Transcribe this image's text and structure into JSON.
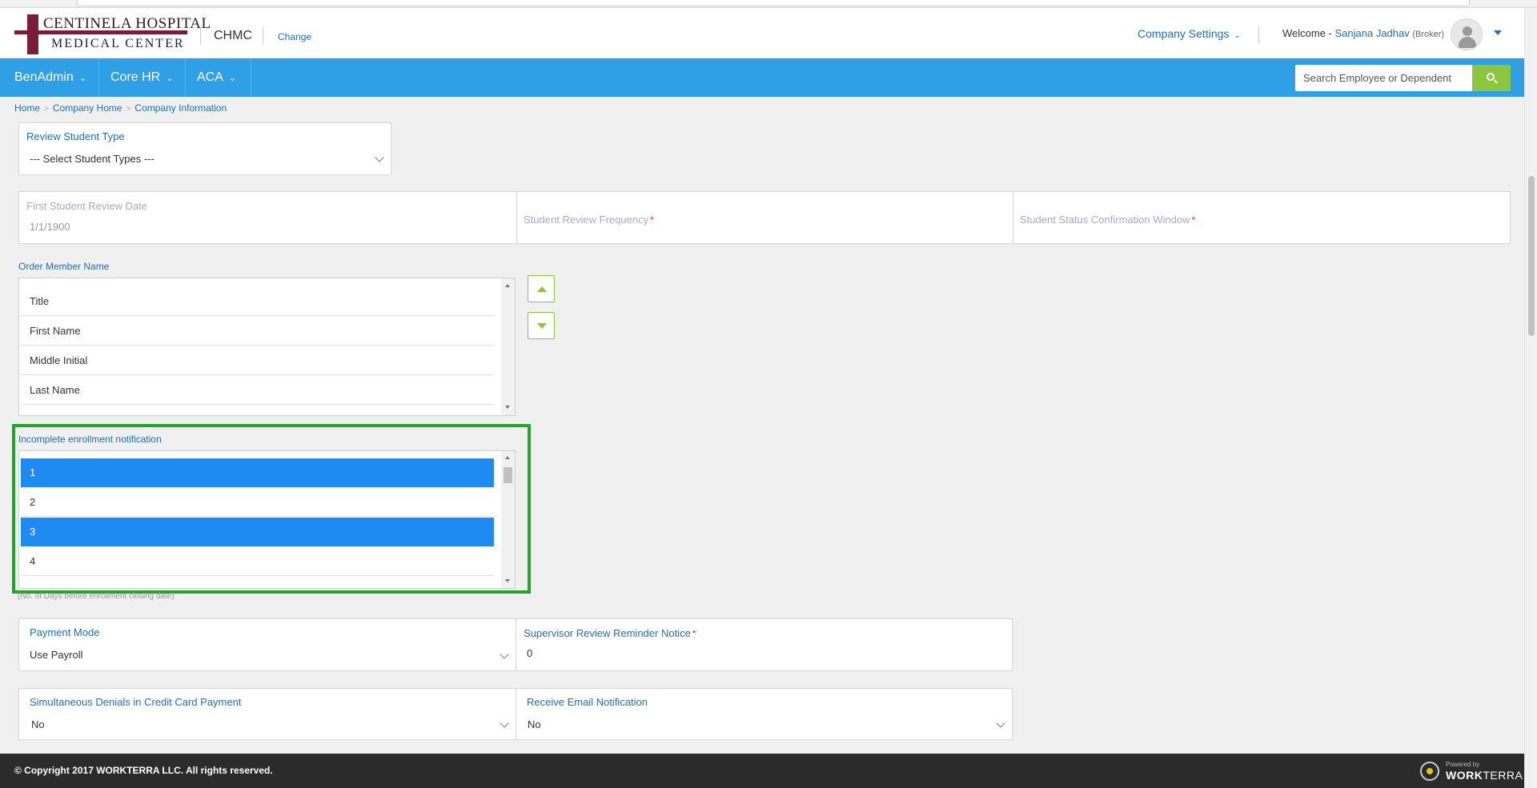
{
  "header": {
    "logo_line1": "CENTINELA HOSPITAL",
    "logo_line2": "MEDICAL  CENTER",
    "company_code": "CHMC",
    "change_link": "Change",
    "company_settings": "Company Settings",
    "welcome_prefix": "Welcome - ",
    "user_name": "Sanjana Jadhav",
    "user_role": "(Broker)"
  },
  "nav": {
    "items": [
      {
        "label": "BenAdmin"
      },
      {
        "label": "Core HR"
      },
      {
        "label": "ACA"
      }
    ],
    "search_placeholder": "Search Employee or Dependent"
  },
  "breadcrumb": [
    "Home",
    "Company Home",
    "Company Information"
  ],
  "review_student_type": {
    "label": "Review Student Type",
    "value": "--- Select Student Types ---"
  },
  "student_review": {
    "first_date_label": "First Student Review Date",
    "first_date_value": "1/1/1900",
    "frequency_label": "Student Review Frequency",
    "confirmation_label": "Student Status Confirmation Window",
    "required_mark": "*"
  },
  "order_member_name": {
    "label": "Order Member Name",
    "items": [
      "Title",
      "First Name",
      "Middle Initial",
      "Last Name"
    ]
  },
  "incomplete_enrollment": {
    "label": "Incomplete enrollment notification",
    "items": [
      {
        "text": "1",
        "selected": true
      },
      {
        "text": "2",
        "selected": false
      },
      {
        "text": "3",
        "selected": true
      },
      {
        "text": "4",
        "selected": false
      }
    ],
    "hint": "(No. of Days before enrollment closing date)"
  },
  "payment": {
    "mode_label": "Payment Mode",
    "mode_value": "Use Payroll",
    "supervisor_label": "Supervisor Review Reminder Notice",
    "supervisor_value": "0",
    "required_mark": "*"
  },
  "denials": {
    "label": "Simultaneous Denials in Credit Card Payment",
    "value": "No",
    "email_label": "Receive Email Notification",
    "email_value": "No"
  },
  "footer": {
    "copyright": "© Copyright 2017 WORKTERRA LLC. All rights reserved.",
    "powered_by": "Powered by",
    "brand_work": "WORK",
    "brand_terra": "TERRA"
  },
  "colors": {
    "nav_blue": "#2f9fe6",
    "link_blue": "#1f6fb5",
    "selected_blue": "#1e8bf2",
    "accent_green": "#8cc63f",
    "highlight_green": "#22a52a",
    "logo_maroon": "#7a1d3a"
  }
}
